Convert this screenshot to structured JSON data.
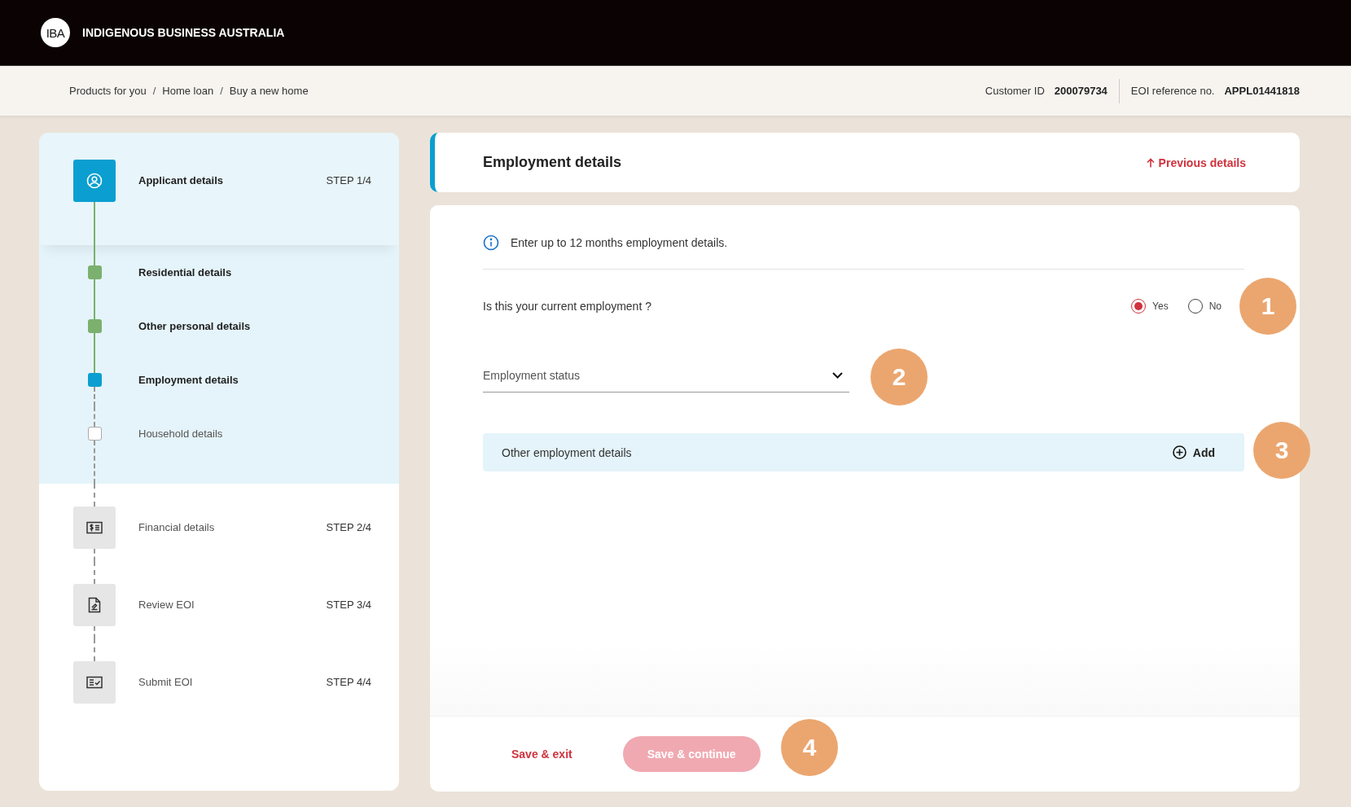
{
  "header": {
    "logo": "IBA",
    "title": "INDIGENOUS BUSINESS AUSTRALIA"
  },
  "breadcrumb": {
    "separator": "/",
    "items": [
      "Products for you",
      "Home loan",
      "Buy a new home"
    ]
  },
  "customer_id": {
    "label": "Customer ID",
    "value": "200079734"
  },
  "eoi_reference": {
    "label": "EOI reference no.",
    "value": "APPL01441818"
  },
  "steps": [
    {
      "label": "Applicant details",
      "step": "STEP 1/4",
      "selected": true,
      "kind": "user",
      "substeps": [
        {
          "label": "Residential details",
          "completed": true,
          "selected": false
        },
        {
          "label": "Other personal details",
          "completed": true,
          "selected": false
        },
        {
          "label": "Employment details",
          "completed": false,
          "selected": true
        },
        {
          "label": "Household details",
          "completed": false,
          "selected": false
        }
      ]
    },
    {
      "label": "Financial details",
      "step": "STEP 2/4",
      "selected": false,
      "kind": "money"
    },
    {
      "label": "Review EOI",
      "step": "STEP 3/4",
      "selected": false,
      "kind": "document"
    },
    {
      "label": "Submit EOI",
      "step": "STEP 4/4",
      "selected": false,
      "kind": "checklist"
    }
  ],
  "section": {
    "title": "Employment details",
    "previous_link": "Previous details"
  },
  "info": "Enter up to 12 months employment details.",
  "question": {
    "label": "Is this your current employment ?",
    "options": [
      {
        "label": "Yes",
        "selected": true
      },
      {
        "label": "No",
        "selected": false
      }
    ]
  },
  "employment_status": {
    "placeholder": "Employment status"
  },
  "other_employment": {
    "label": "Other employment details",
    "action": "Add"
  },
  "buttons": [
    {
      "label": "Save & exit",
      "kind": "link"
    },
    {
      "label": "Save & continue",
      "kind": "primary",
      "disabled": true
    }
  ],
  "annotations": [
    "1",
    "2",
    "3",
    "4"
  ]
}
